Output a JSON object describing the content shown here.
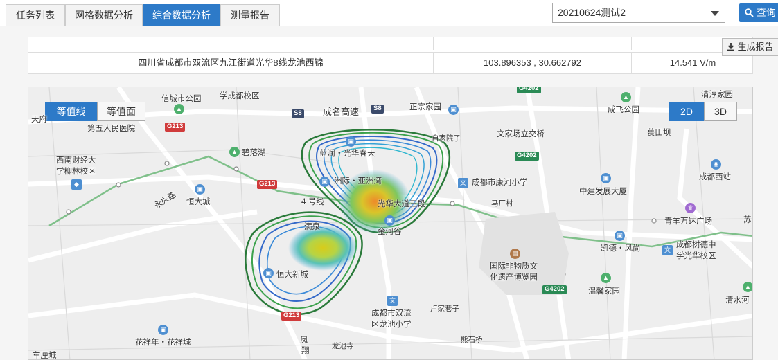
{
  "tabs": [
    "任务列表",
    "网格数据分析",
    "综合数据分析",
    "测量报告"
  ],
  "active_tab": 2,
  "task_select": {
    "value": "20210624测试2"
  },
  "query_button": "查询",
  "generate_report_button": "生成报告",
  "table": {
    "rows": [
      {
        "address": "四川省成都市双流区九江街道光华8线龙池西锦",
        "coords": "103.896353 , 30.662792",
        "value": "14.541 V/m"
      }
    ]
  },
  "map": {
    "mode_toggle": [
      "等值线",
      "等值面"
    ],
    "view_toggle": [
      "2D",
      "3D"
    ],
    "labels": {
      "xinyang": "信城市公园",
      "xuechengdu": "学成都校区",
      "tianfu": "天府",
      "wuren": "第五人民医院",
      "chengming": "成名高速",
      "zhengzong": "正宗家园",
      "xinan": "西南财经大",
      "xuelin": "学柳林校区",
      "biluo": "碧落湖",
      "yongxing": "永兴路",
      "hengda": "恒大城",
      "four_line": "4 号线",
      "lanrun": "蓝润・光华春天",
      "zhoujie": "洲际・亚洲湾",
      "guanghua": "光华大道三段",
      "jinhe": "金河谷",
      "yuanjia": "自家院子",
      "wenjia": "文家场立交桥",
      "kanghe": "成都市康河小学",
      "mahang": "马厂村",
      "zhongjian": "中建发展大厦",
      "qingyue": "清淳家园",
      "chengfei": "成飞公园",
      "jiatian": "蒉田坝",
      "xizhan": "成都西站",
      "wanda": "青羊万达广场",
      "su": "苏",
      "kaide": "凯德・风尚",
      "shude1": "成都树德中",
      "shude2": "学光华校区",
      "feiyi1": "国际非物质文",
      "feiyi2": "化遗产博览园",
      "wenxin": "温馨家园",
      "qingshui": "清水河",
      "manquan": "满泉",
      "hengdaxin": "恒大新城",
      "longchi1": "成都市双流",
      "longchi2": "区龙池小学",
      "lujia": "卢家巷子",
      "xiongshi": "熊石桥",
      "longchisi": "龙池寺",
      "huaxiang": "花祥年・花祥城",
      "feng": "凤",
      "xiang": "翔",
      "cheyuan": "车厘城"
    },
    "road_shields": [
      "G213",
      "S8",
      "S8",
      "G4202",
      "G213",
      "G4202",
      "G4202",
      "G213"
    ]
  }
}
